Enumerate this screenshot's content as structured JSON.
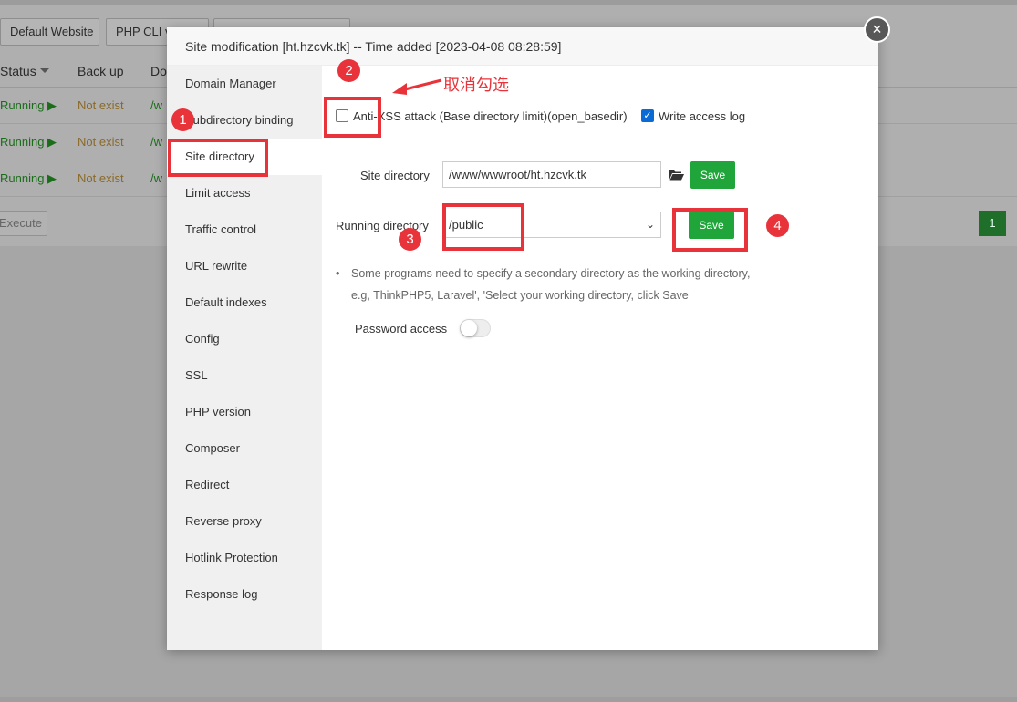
{
  "background": {
    "buttons": [
      "Default Website",
      "PHP CLI v",
      ""
    ],
    "headers": [
      "Status",
      "Back up",
      "Do"
    ],
    "rows": [
      {
        "status": "Running",
        "backup": "Not exist",
        "domain": "/w"
      },
      {
        "status": "Running",
        "backup": "Not exist",
        "domain": "/w"
      },
      {
        "status": "Running",
        "backup": "Not exist",
        "domain": "/w"
      }
    ],
    "execute_label": "Execute",
    "page_number": "1"
  },
  "modal": {
    "title": "Site modification [ht.hzcvk.tk] -- Time added [2023-04-08 08:28:59]",
    "close_symbol": "×",
    "sidebar": [
      "Domain Manager",
      "Subdirectory binding",
      "Site directory",
      "Limit access",
      "Traffic control",
      "URL rewrite",
      "Default indexes",
      "Config",
      "SSL",
      "PHP version",
      "Composer",
      "Redirect",
      "Reverse proxy",
      "Hotlink Protection",
      "Response log"
    ],
    "active_item": "Site directory",
    "anti_xss_label": "Anti-XSS attack (Base directory limit)(open_basedir)",
    "anti_xss_checked": false,
    "write_log_label": "Write access log",
    "write_log_checked": true,
    "site_directory_label": "Site directory",
    "site_directory_value": "/www/wwwroot/ht.hzcvk.tk",
    "save_label": "Save",
    "running_directory_label": "Running directory",
    "running_directory_value": "/public",
    "tip_line1": "Some programs need to specify a secondary directory as the working directory,",
    "tip_line2": "e.g, ThinkPHP5, Laravel', 'Select your working directory, click Save",
    "password_access_label": "Password access",
    "password_access_enabled": false
  },
  "annotations": {
    "numbers": [
      "1",
      "2",
      "3",
      "4"
    ],
    "uncheck_note": "取消勾选",
    "color": "#e8333a"
  }
}
